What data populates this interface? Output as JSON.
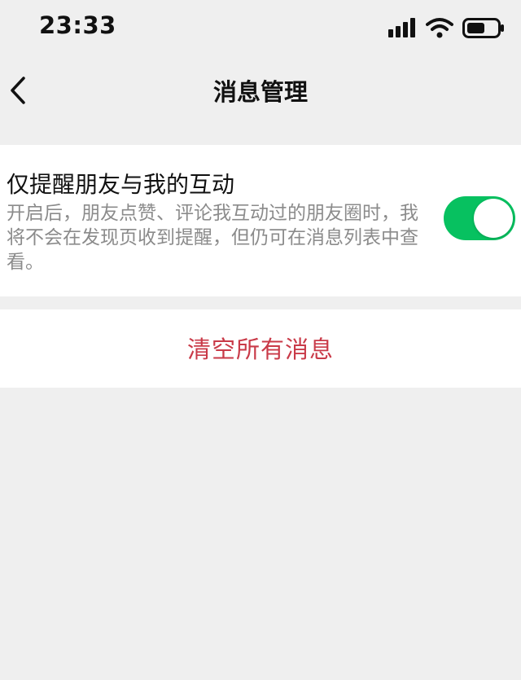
{
  "status_bar": {
    "time": "23:33",
    "icons": [
      "signal-icon",
      "wifi-icon",
      "battery-icon"
    ]
  },
  "header": {
    "back_icon": "chevron-left-icon",
    "title": "消息管理"
  },
  "setting": {
    "title": "仅提醒朋友与我的互动",
    "description": "开启后，朋友点赞、评论我互动过的朋友圈时，我将不会在发现页收到提醒，但仍可在消息列表中查看。",
    "toggle_on": true
  },
  "actions": {
    "clear_label": "清空所有消息"
  },
  "colors": {
    "background": "#efefef",
    "card": "#ffffff",
    "accent_green": "#07c160",
    "danger_red": "#c93a48",
    "secondary_text": "#8b8b8b"
  }
}
